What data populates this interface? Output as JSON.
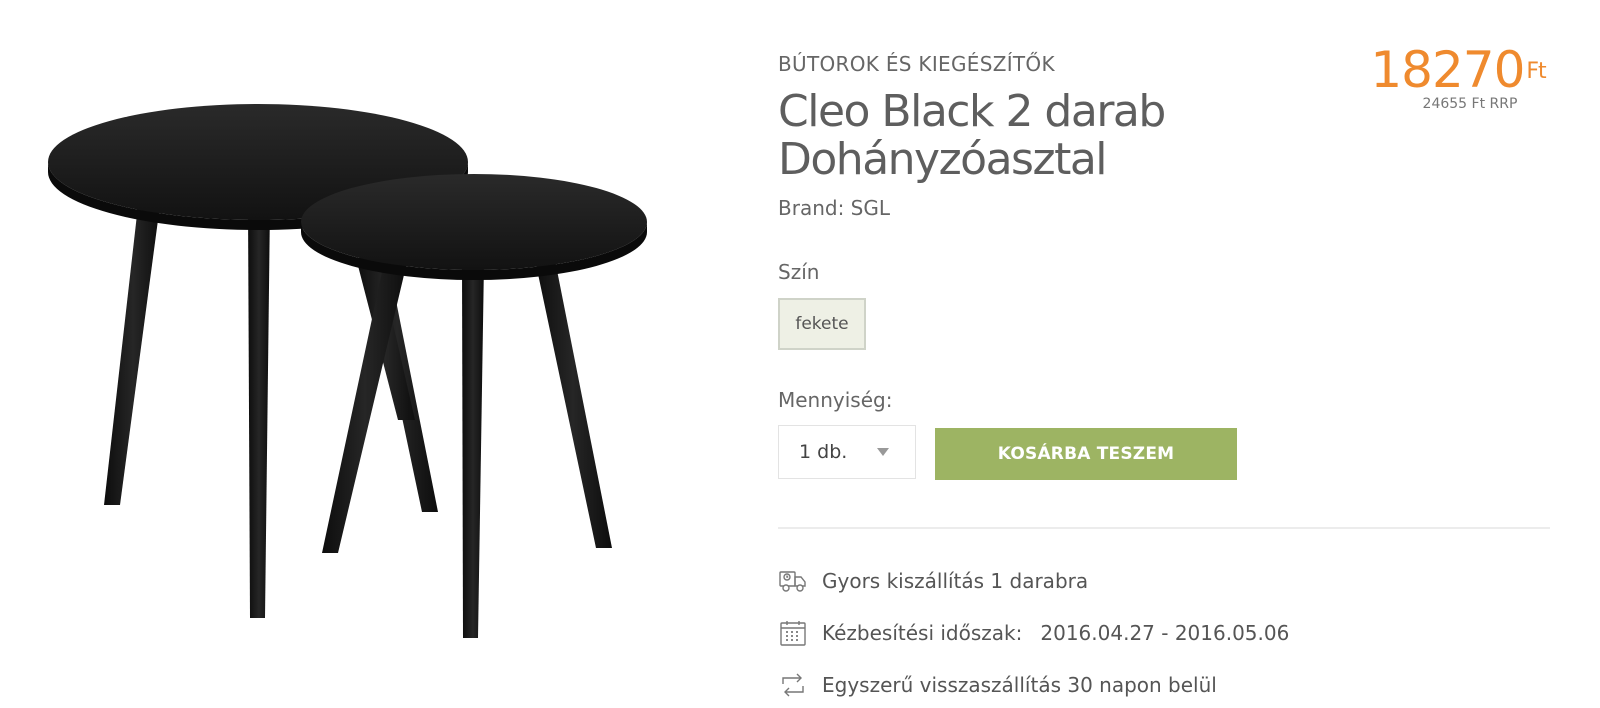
{
  "product": {
    "category": "BÚTOROK ÉS KIEGÉSZÍTŐK",
    "title": "Cleo Black 2 darab Dohányzóasztal",
    "brand": "Brand: SGL",
    "image_alt": "product-photo-two-black-tables"
  },
  "price": {
    "amount": "18270",
    "currency": "Ft",
    "rrp": "24655 Ft RRP",
    "color": "#ef8a2e"
  },
  "color_option": {
    "label": "Szín",
    "selected": "fekete"
  },
  "quantity": {
    "label": "Mennyiség:",
    "selected": "1 db."
  },
  "cart": {
    "button_label": "KOSÁRBA TESZEM",
    "color": "#9db463"
  },
  "features": {
    "delivery": {
      "icon": "truck-icon",
      "text": "Gyors kiszállítás 1 darabra"
    },
    "period": {
      "icon": "calendar-icon",
      "label": "Kézbesítési időszak:",
      "range": "2016.04.27 - 2016.05.06"
    },
    "returns": {
      "icon": "return-arrows-icon",
      "text": "Egyszerű visszaszállítás 30 napon belül"
    }
  }
}
